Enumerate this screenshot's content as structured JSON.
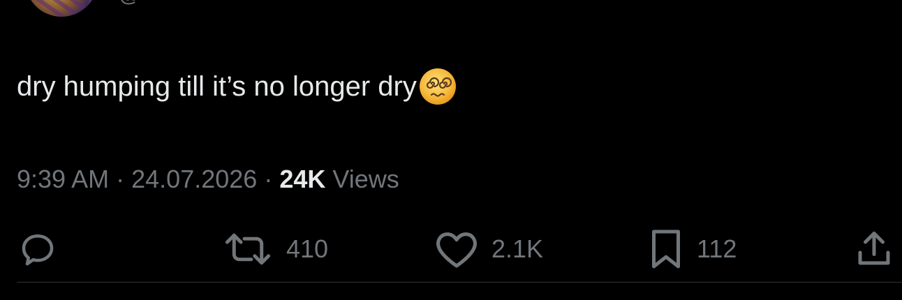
{
  "tweet": {
    "handle": "@",
    "text": "dry humping till it’s no longer dry",
    "emoji": "face-with-spiral-eyes",
    "time": "9:39 AM",
    "separator": "·",
    "date": "24.07.2026",
    "views_count": "24K",
    "views_label": "Views"
  },
  "actions": {
    "reply": {
      "icon": "reply-icon"
    },
    "retweet": {
      "icon": "retweet-icon",
      "count": "410"
    },
    "like": {
      "icon": "heart-icon",
      "count": "2.1K"
    },
    "bookmark": {
      "icon": "bookmark-icon",
      "count": "112"
    },
    "share": {
      "icon": "share-icon"
    }
  },
  "colors": {
    "background": "#000000",
    "text": "#e7e9ea",
    "muted": "#71767b",
    "divider": "#2f3336"
  }
}
